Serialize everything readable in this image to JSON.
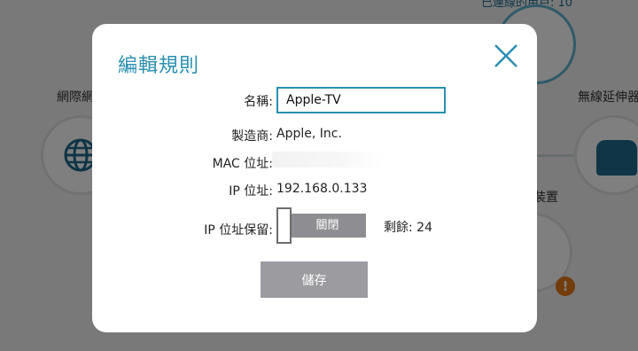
{
  "background": {
    "top_text": "已連線的用戶: 10",
    "label_internet": "網際網",
    "label_extender": "無線延伸器",
    "label_devices": "裝置"
  },
  "dialog": {
    "title": "編輯規則",
    "fields": {
      "name_label": "名稱:",
      "name_value": "Apple-TV",
      "manufacturer_label": "製造商:",
      "manufacturer_value": "Apple, Inc.",
      "mac_label": "MAC 位址:",
      "ip_label": "IP 位址:",
      "ip_value": "192.168.0.133",
      "reserve_label": "IP 位址保留:",
      "reserve_toggle_text": "關閉",
      "remaining_text": "剩餘: 24"
    },
    "save_label": "儲存"
  },
  "colors": {
    "accent": "#2a8fb0",
    "toggle_off": "#8e8e92",
    "button_disabled": "#9b9ba0",
    "warning": "#e67817"
  }
}
